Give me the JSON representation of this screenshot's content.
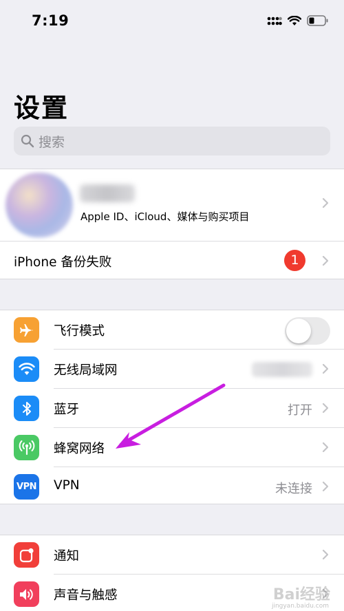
{
  "status": {
    "time": "7:19"
  },
  "title": "设置",
  "search": {
    "placeholder": "搜索"
  },
  "profile": {
    "subtitle": "Apple ID、iCloud、媒体与购买项目"
  },
  "backup": {
    "label": "iPhone 备份失败",
    "badge": "1"
  },
  "group2": [
    {
      "label": "飞行模式",
      "icon": "airplane-icon",
      "color": "#f7a133",
      "toggle": false
    },
    {
      "label": "无线局域网",
      "icon": "wifi-icon",
      "color": "#1b8cf7"
    },
    {
      "label": "蓝牙",
      "icon": "bluetooth-icon",
      "color": "#1b8cf7",
      "value": "打开"
    },
    {
      "label": "蜂窝网络",
      "icon": "cellular-icon",
      "color": "#4ac964"
    },
    {
      "label": "VPN",
      "icon": "vpn-icon",
      "color": "#1b74e8",
      "value": "未连接",
      "icon_text": "VPN"
    }
  ],
  "group3": [
    {
      "label": "通知",
      "icon": "notification-icon",
      "color": "#f13f3a"
    },
    {
      "label": "声音与触感",
      "icon": "sound-icon",
      "color": "#f13f5c"
    }
  ],
  "watermark": {
    "main": "Bai经验",
    "sub": "jingyan.baidu.com"
  }
}
